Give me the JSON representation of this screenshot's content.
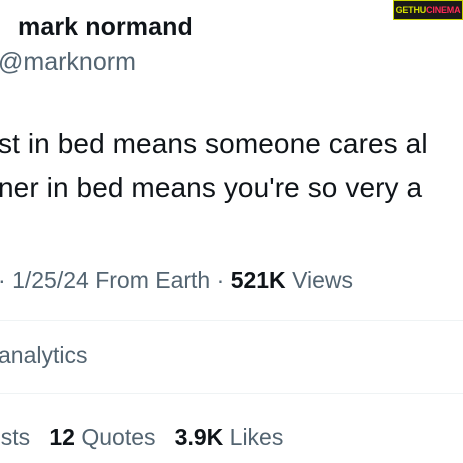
{
  "tweet": {
    "display_name": "mark normand",
    "handle": "@marknorm",
    "text_lines": [
      "st in bed means someone cares al",
      "ner in bed means you're so very a"
    ],
    "meta": {
      "lead": "·",
      "date": "1/25/24",
      "source": "From Earth",
      "separator": "·",
      "views_count": "521K",
      "views_label": "Views"
    },
    "analytics_label": "analytics",
    "stats": {
      "reposts_label": "osts",
      "quotes_count": "12",
      "quotes_label": "Quotes",
      "likes_count": "3.9K",
      "likes_label": "Likes"
    }
  },
  "watermark": {
    "part1": "GETHU",
    "part2": "CINEMA"
  }
}
